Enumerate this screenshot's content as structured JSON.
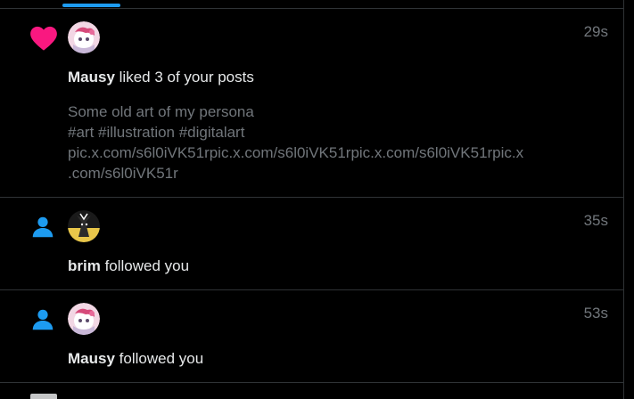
{
  "colors": {
    "background": "#000000",
    "accent": "#1d9bf0",
    "like": "#f91880",
    "divider": "#2f3336",
    "muted_text": "#71767b",
    "primary_text": "#e7e9ea"
  },
  "notifications": [
    {
      "type_icon": "heart-icon",
      "timestamp": "29s",
      "user": "Mausy",
      "action": " liked 3 of your posts",
      "post_lines": [
        "Some old art of my persona",
        "#art #illustration #digitalart",
        "pic.x.com/s6l0iVK51rpic.x.com/s6l0iVK51rpic.x.com/s6l0iVK51rpic.x",
        ".com/s6l0iVK51r"
      ]
    },
    {
      "type_icon": "person-icon",
      "timestamp": "35s",
      "user": "brim",
      "action": " followed you"
    },
    {
      "type_icon": "person-icon",
      "timestamp": "53s",
      "user": "Mausy",
      "action": " followed you"
    }
  ]
}
